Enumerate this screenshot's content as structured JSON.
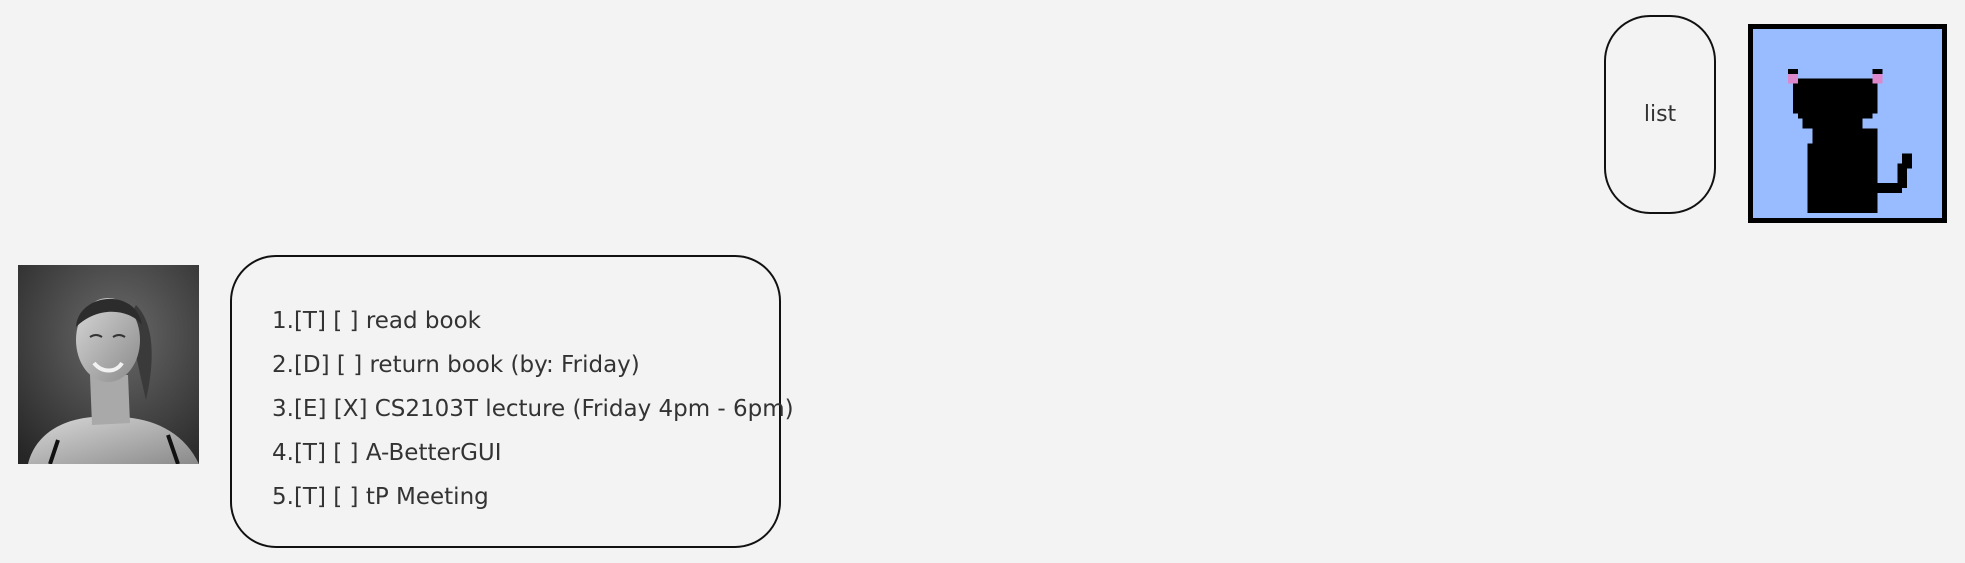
{
  "user_message": {
    "text": "list"
  },
  "bot_message": {
    "lines": [
      "1.[T] [ ] read book",
      "2.[D] [ ] return book (by: Friday)",
      "3.[E] [X] CS2103T lecture (Friday 4pm - 6pm)",
      "4.[T] [ ] A-BetterGUI",
      "5.[T] [ ] tP Meeting"
    ]
  },
  "colors": {
    "background": "#f3f3f3",
    "bubble_border": "#111111",
    "cat_avatar_bg": "#99bbff",
    "cat_ear_pink": "#dd88cc"
  },
  "icons": {
    "user_avatar": "pixel-black-cat-avatar",
    "bot_avatar": "smiling-woman-photo-avatar"
  }
}
